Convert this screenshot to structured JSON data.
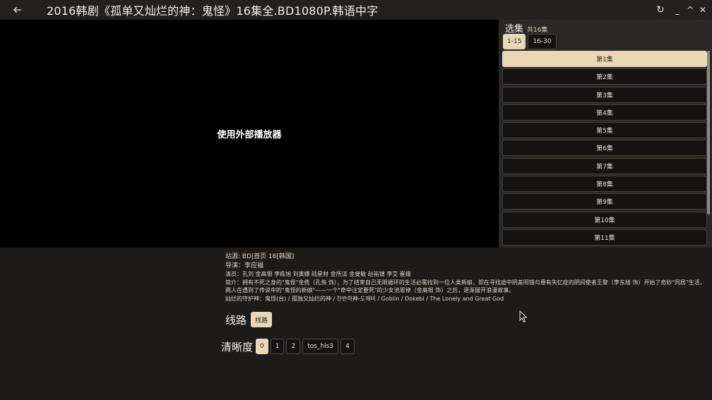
{
  "titlebar": {
    "back_icon": "arrow-left-icon",
    "title": "2016韩剧《孤单又灿烂的神：鬼怪》16集全.BD1080P.韩语中字",
    "refresh_glyph": "↻",
    "minimize_glyph": "_",
    "maximize_glyph": "^",
    "close_glyph": "✕"
  },
  "player": {
    "external_label": "使用外部播放器"
  },
  "episodes": {
    "heading": "选集",
    "count": "共16集",
    "ranges": [
      {
        "label": "1-15",
        "active": true
      },
      {
        "label": "16-30",
        "active": false
      }
    ],
    "items": [
      {
        "label": "第1集",
        "active": true
      },
      {
        "label": "第2集",
        "active": false
      },
      {
        "label": "第3集",
        "active": false
      },
      {
        "label": "第4集",
        "active": false
      },
      {
        "label": "第5集",
        "active": false
      },
      {
        "label": "第6集",
        "active": false
      },
      {
        "label": "第7集",
        "active": false
      },
      {
        "label": "第8集",
        "active": false
      },
      {
        "label": "第9集",
        "active": false
      },
      {
        "label": "第10集",
        "active": false
      },
      {
        "label": "第11集",
        "active": false
      }
    ]
  },
  "info": {
    "source": "站源: BD|首页 16[韩国]",
    "director": "导演：李应福",
    "cast": "演员：孔刘 金高银 李栋旭 刘寅娜 陆星材 金所泫 金叟敏 赵祐镇 李艾 崔雄",
    "synopsis_1": "简介：拥有不死之身的\"鬼怪\"金侁（孔侑 饰），为了结束自己无限循环的生活必需找到一位人类新娘，却在寻找途中阴差阳错与患有失忆症的阴间使者王黎（李东旭 饰）开始了奇妙\"同居\"生活，",
    "synopsis_2": "两人在遇到了传说中的\"鬼怪的新娘\"——一个\"命中注定要死\"的少女池恩倬（金高银 饰）之后，逐渐展开浪漫故事。",
    "alt_names": "灿烂的守护神：鬼怪(台) / 孤独又灿烂的神 / 찬란하神-도깨비 / Goblin / Dokebi / The Lonely and Great God"
  },
  "routes": {
    "label": "线路",
    "items": [
      {
        "label": "线路",
        "active": true
      }
    ]
  },
  "quality": {
    "label": "清晰度",
    "items": [
      {
        "label": "0",
        "active": true
      },
      {
        "label": "1",
        "active": false
      },
      {
        "label": "2",
        "active": false
      },
      {
        "label": "tos_hls3",
        "active": false
      },
      {
        "label": "4",
        "active": false
      }
    ]
  },
  "colors": {
    "accent": "#e9d8b6",
    "background": "#1c1b19",
    "panel": "#2a2824",
    "video": "#000000"
  }
}
